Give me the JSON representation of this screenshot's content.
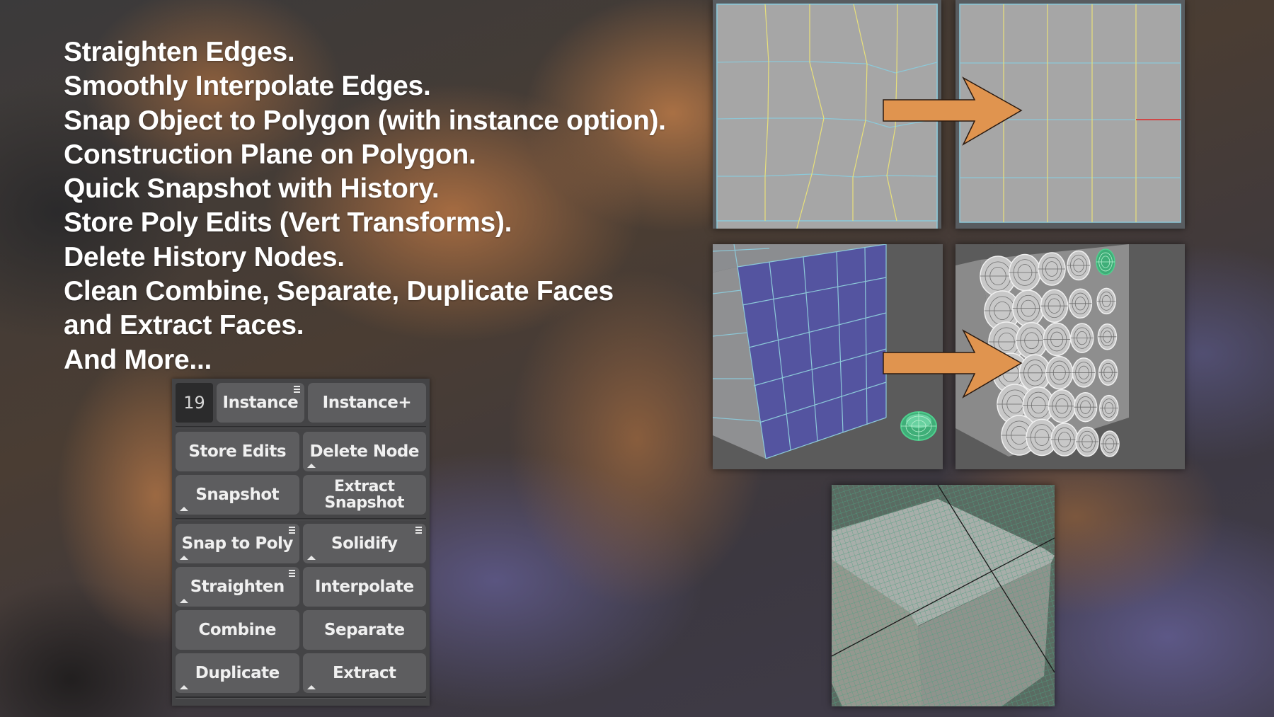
{
  "features": [
    "Straighten Edges.",
    "Smoothly Interpolate Edges.",
    "Snap Object to Polygon (with instance option).",
    "Construction Plane on Polygon.",
    "Quick Snapshot with History.",
    "Store Poly Edits (Vert Transforms).",
    "Delete History Nodes.",
    "Clean Combine, Separate, Duplicate Faces",
    "and Extract Faces.",
    "And More..."
  ],
  "panel": {
    "instance_count": "19",
    "buttons": {
      "instance": "Instance",
      "instance_plus": "Instance+",
      "store_edits": "Store Edits",
      "delete_node": "Delete Node",
      "snapshot": "Snapshot",
      "extract_snapshot_line1": "Extract",
      "extract_snapshot_line2": "Snapshot",
      "snap_to_poly": "Snap to Poly",
      "solidify": "Solidify",
      "straighten": "Straighten",
      "interpolate": "Interpolate",
      "combine": "Combine",
      "separate": "Separate",
      "duplicate": "Duplicate",
      "extract": "Extract"
    }
  },
  "colors": {
    "arrow": "#e0944f",
    "viewport_gray": "#a6a6a6",
    "edge_yellow": "#e8e07a",
    "edge_blue": "#8cc8d8",
    "face_selected": "#5454a0",
    "object_selected": "#4fd08e",
    "edge_red": "#d04848"
  },
  "images": {
    "straighten_before": "straighten-edges-before",
    "straighten_after": "straighten-edges-after",
    "snap_before": "snap-to-poly-before",
    "snap_after": "snap-to-poly-after",
    "construction_plane": "construction-plane-on-polygon"
  }
}
